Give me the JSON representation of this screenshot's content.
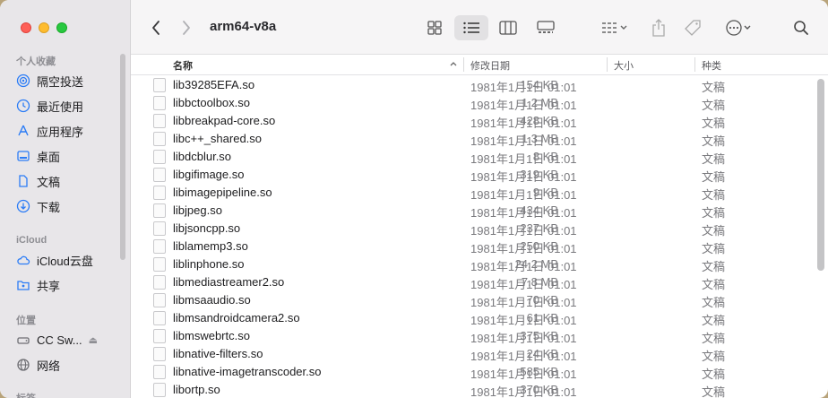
{
  "window": {
    "title": "arm64-v8a"
  },
  "sidebar": {
    "favorites_title": "个人收藏",
    "favorites": [
      {
        "label": "隔空投送",
        "icon": "airdrop-icon"
      },
      {
        "label": "最近使用",
        "icon": "clock-icon"
      },
      {
        "label": "应用程序",
        "icon": "applications-icon"
      },
      {
        "label": "桌面",
        "icon": "desktop-icon"
      },
      {
        "label": "文稿",
        "icon": "document-icon"
      },
      {
        "label": "下载",
        "icon": "download-icon"
      }
    ],
    "icloud_title": "iCloud",
    "icloud": [
      {
        "label": "iCloud云盘",
        "icon": "cloud-icon"
      },
      {
        "label": "共享",
        "icon": "shared-folder-icon"
      }
    ],
    "locations_title": "位置",
    "locations": [
      {
        "label": "CC Sw...",
        "icon": "drive-icon"
      },
      {
        "label": "网络",
        "icon": "network-icon"
      }
    ],
    "tags_title": "标签"
  },
  "table": {
    "headers": {
      "name": "名称",
      "date": "修改日期",
      "size": "大小",
      "kind": "种类"
    },
    "rows": [
      {
        "name": "lib39285EFA.so",
        "date": "1981年1月1日 01:01",
        "size": "154 KB",
        "kind": "文稿"
      },
      {
        "name": "libbctoolbox.so",
        "date": "1981年1月1日 01:01",
        "size": "1.2 MB",
        "kind": "文稿"
      },
      {
        "name": "libbreakpad-core.so",
        "date": "1981年1月1日 01:01",
        "size": "428 KB",
        "kind": "文稿"
      },
      {
        "name": "libc++_shared.so",
        "date": "1981年1月1日 01:01",
        "size": "1.3 MB",
        "kind": "文稿"
      },
      {
        "name": "libdcblur.so",
        "date": "1981年1月1日 01:01",
        "size": "8 KB",
        "kind": "文稿"
      },
      {
        "name": "libgifimage.so",
        "date": "1981年1月1日 01:01",
        "size": "319 KB",
        "kind": "文稿"
      },
      {
        "name": "libimagepipeline.so",
        "date": "1981年1月1日 01:01",
        "size": "9 KB",
        "kind": "文稿"
      },
      {
        "name": "libjpeg.so",
        "date": "1981年1月1日 01:01",
        "size": "434 KB",
        "kind": "文稿"
      },
      {
        "name": "libjsoncpp.so",
        "date": "1981年1月1日 01:01",
        "size": "237 KB",
        "kind": "文稿"
      },
      {
        "name": "liblamemp3.so",
        "date": "1981年1月1日 01:01",
        "size": "250 KB",
        "kind": "文稿"
      },
      {
        "name": "liblinphone.so",
        "date": "1981年1月1日 01:01",
        "size": "24.2 MB",
        "kind": "文稿"
      },
      {
        "name": "libmediastreamer2.so",
        "date": "1981年1月1日 01:01",
        "size": "7.8 MB",
        "kind": "文稿"
      },
      {
        "name": "libmsaaudio.so",
        "date": "1981年1月1日 01:01",
        "size": "70 KB",
        "kind": "文稿"
      },
      {
        "name": "libmsandroidcamera2.so",
        "date": "1981年1月1日 01:01",
        "size": "61 KB",
        "kind": "文稿"
      },
      {
        "name": "libmswebrtc.so",
        "date": "1981年1月1日 01:01",
        "size": "375 KB",
        "kind": "文稿"
      },
      {
        "name": "libnative-filters.so",
        "date": "1981年1月1日 01:01",
        "size": "24 KB",
        "kind": "文稿"
      },
      {
        "name": "libnative-imagetranscoder.so",
        "date": "1981年1月1日 01:01",
        "size": "585 KB",
        "kind": "文稿"
      },
      {
        "name": "libortp.so",
        "date": "1981年1月1日 01:01",
        "size": "370 KB",
        "kind": "文稿"
      }
    ]
  }
}
